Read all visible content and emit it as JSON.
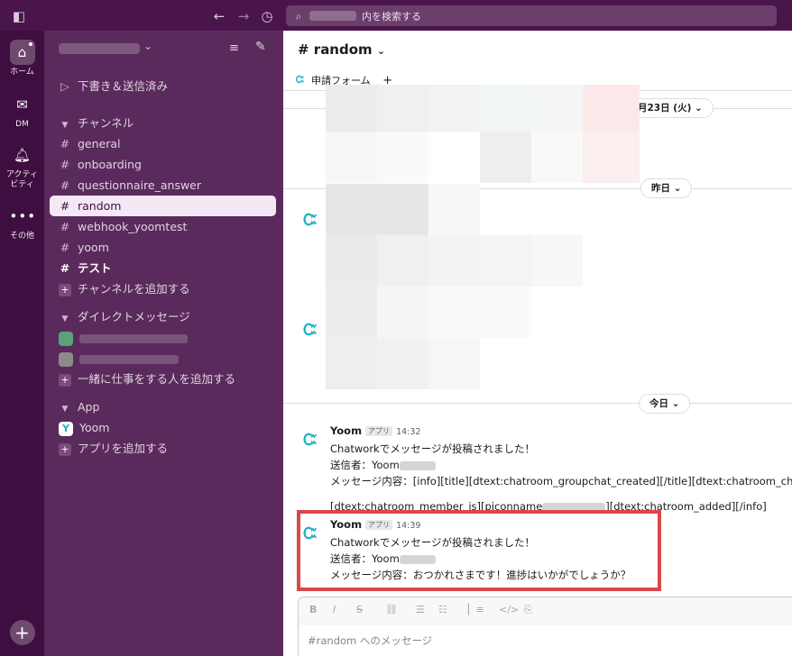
{
  "search": {
    "placeholder": "内を検索する"
  },
  "rail": {
    "home": "ホーム",
    "dm": "DM",
    "activity": "アクティ\nビティ",
    "more": "その他"
  },
  "sidebar": {
    "drafts": "下書き＆送信済み",
    "channels_header": "チャンネル",
    "channels": [
      "general",
      "onboarding",
      "questionnaire_answer",
      "random",
      "webhook_yoomtest",
      "yoom",
      "テスト"
    ],
    "add_channel": "チャンネルを追加する",
    "dm_header": "ダイレクトメッセージ",
    "add_people": "一緒に仕事をする人を追加する",
    "app_header": "App",
    "app_yoom": "Yoom",
    "add_app": "アプリを追加する"
  },
  "channel": {
    "title": "# random",
    "tab_form": "申請フォーム",
    "tab_add": "+"
  },
  "dates": {
    "first": "月23日 (火)",
    "yesterday": "昨日",
    "today": "今日"
  },
  "messages": [
    {
      "name": "Yoom",
      "badge": "アプリ",
      "time": "14:32",
      "line1": "Chatworkでメッセージが投稿されました！",
      "line2": "送信者：Yoom",
      "line3": "メッセージ内容：[info][title][dtext:chatroom_groupchat_created][/title][dtext:chatroom_chatname_is]",
      "line4a": "[dtext:chatroom_member_is][piconname",
      "line4b": "][dtext:chatroom_added][/info]"
    },
    {
      "name": "Yoom",
      "badge": "アプリ",
      "time": "14:39",
      "line1": "Chatworkでメッセージが投稿されました！",
      "line2": "送信者：Yoom",
      "line3": "メッセージ内容：おつかれさまです！進捗はいかがでしょうか？"
    }
  ],
  "composer": {
    "placeholder": "#random へのメッセージ",
    "tools": [
      "B",
      "I",
      "S",
      "link",
      "ol",
      "ul",
      "quote",
      "code",
      "codeblock"
    ]
  },
  "colors": {
    "topbar": "#4a154b",
    "rail": "#3f0e40",
    "sidebar": "#5b2a5c",
    "highlight": "#d9474b",
    "app_accent": "#23b0c2"
  }
}
